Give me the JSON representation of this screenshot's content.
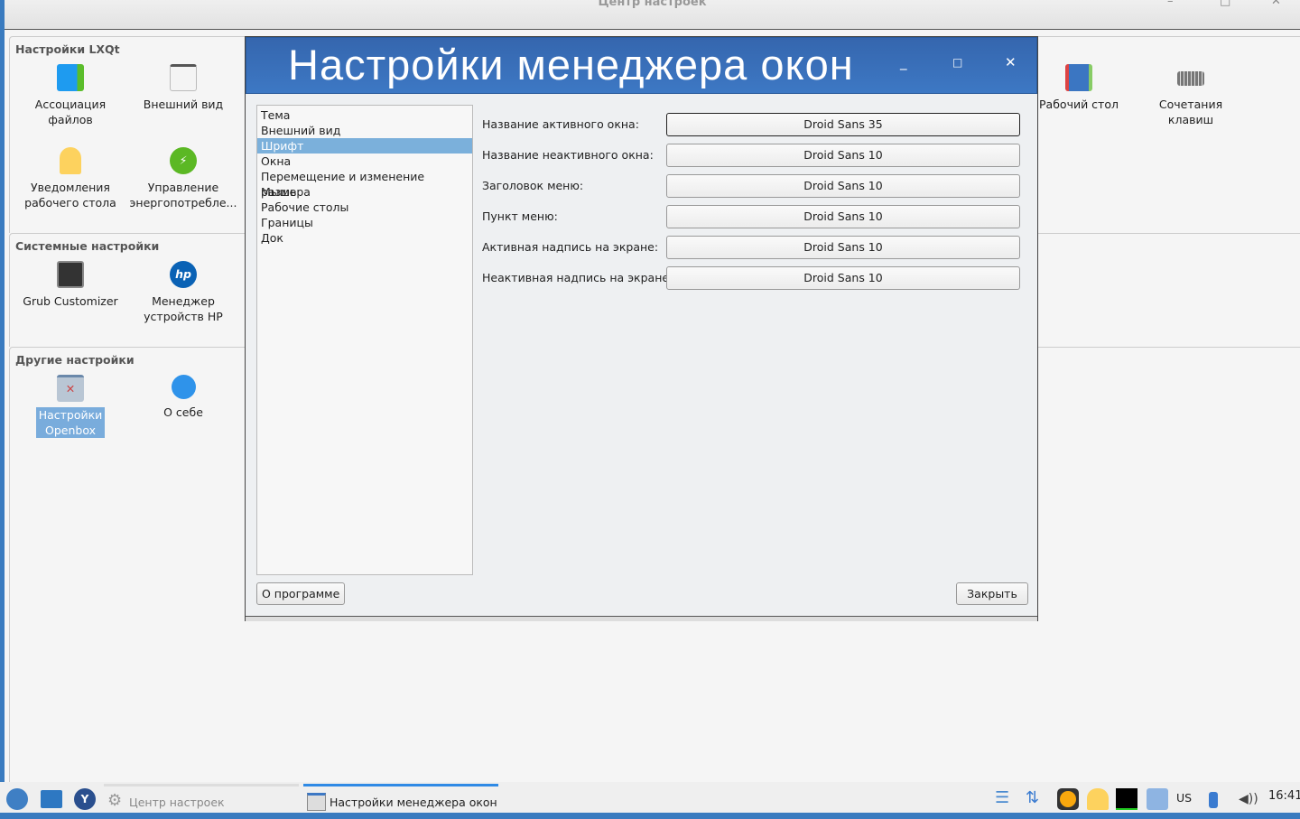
{
  "bg_window": {
    "title": "Центр настроек",
    "min": "–",
    "max": "□",
    "close": "✕"
  },
  "groups": [
    {
      "title": "Настройки LXQt",
      "items": [
        "Ассоциация\nфайлов",
        "Внешний вид",
        "Уведомления\nрабочего стола",
        "Управление\nэнергопотребле...",
        "Рабочий стол",
        "Сочетания\nклавиш"
      ]
    },
    {
      "title": "Системные настройки",
      "items": [
        "Grub Customizer",
        "Менеджер\nустройств HP"
      ]
    },
    {
      "title": "Другие настройки",
      "items": [
        "Настройки\nOpenbox",
        "О себе"
      ]
    }
  ],
  "dialog": {
    "title": "Настройки менеджера окон",
    "min": "_",
    "max": "□",
    "close": "✕",
    "nav": [
      "Тема",
      "Внешний вид",
      "Шрифт",
      "Окна",
      "Перемещение и изменение размера",
      "Мышь",
      "Рабочие столы",
      "Границы",
      "Док"
    ],
    "selected_nav": "Шрифт",
    "fonts": [
      {
        "label": "Название активного окна:",
        "value": "Droid Sans 35"
      },
      {
        "label": "Название неактивного окна:",
        "value": "Droid Sans 10"
      },
      {
        "label": "Заголовок меню:",
        "value": "Droid Sans 10"
      },
      {
        "label": "Пункт меню:",
        "value": "Droid Sans 10"
      },
      {
        "label": "Активная надпись на экране:",
        "value": "Droid Sans 10"
      },
      {
        "label": "Неактивная надпись на экране:",
        "value": "Droid Sans 10"
      }
    ],
    "about_button": "О программе",
    "close_button": "Закрыть"
  },
  "taskbar": {
    "tasks": [
      "Центр настроек",
      "Настройки менеджера окон"
    ],
    "keyboard_layout": "US",
    "clock": "16:41"
  },
  "colors": {
    "accent": "#3d78c4",
    "selection": "#7bb0db"
  }
}
